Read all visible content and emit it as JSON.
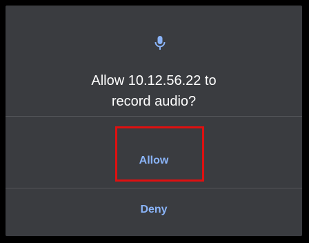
{
  "dialog": {
    "icon": "mic-icon",
    "message_line1": "Allow 10.12.56.22 to",
    "message_line2": "record audio?",
    "allow_label": "Allow",
    "deny_label": "Deny"
  },
  "colors": {
    "background": "#000000",
    "dialog_bg": "#3a3c40",
    "accent": "#8ab4f8",
    "highlight": "#e01010"
  }
}
